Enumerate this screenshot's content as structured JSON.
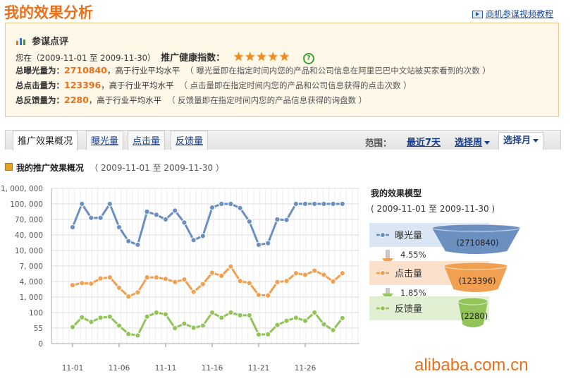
{
  "page": {
    "title": "我的效果分析",
    "tutorial_link": "商机参谋视频教程"
  },
  "summary": {
    "heading": "参谋点评",
    "period_prefix": "您在（",
    "period": "2009-11-01 至 2009-11-30",
    "period_suffix": "）",
    "health_label": "推广健康指数：",
    "health_stars": 5,
    "star_glyph": "★",
    "help_glyph": "?",
    "rows": [
      {
        "label": "总曝光量为：",
        "value": "2710840",
        "compare": "，高于行业平均水平",
        "note": "（ 曝光量即在指定时间内您的产品和公司信息在阿里巴巴中文站被买家看到的次数 ）"
      },
      {
        "label": "总点击量为：",
        "value": "123396",
        "compare": "，高于行业平均水平",
        "note": "（ 点击量即在指定时间内您的产品和公司信息获得的点击次数 ）"
      },
      {
        "label": "总反馈量为：",
        "value": "2280",
        "compare": "，高于行业平均水平",
        "note": "（ 反馈量即在指定时间内您的产品信息获得的询盘数 ）"
      }
    ]
  },
  "tabs": [
    {
      "label": "推广效果概况",
      "active": true
    },
    {
      "label": "曝光量",
      "active": false
    },
    {
      "label": "点击量",
      "active": false
    },
    {
      "label": "反馈量",
      "active": false
    }
  ],
  "range": {
    "label": "范围：",
    "last7": "最近7天",
    "week": "选择周",
    "month": "选择月"
  },
  "section": {
    "title": "我的推广效果概况",
    "period": "（ 2009-11-01 至 2009-11-30 ）"
  },
  "chart_data": {
    "type": "line",
    "y_ticks": [
      "1, 000, 000",
      "100, 000",
      "70, 000",
      "40, 000",
      "10, 000",
      "7, 000",
      "4, 000",
      "1, 000",
      "100",
      "55",
      "0"
    ],
    "x_ticks": [
      {
        "label": "11-01",
        "index": 0
      },
      {
        "label": "11-06",
        "index": 5
      },
      {
        "label": "11-11",
        "index": 10
      },
      {
        "label": "11-16",
        "index": 15
      },
      {
        "label": "11-21",
        "index": 20
      },
      {
        "label": "11-26",
        "index": 25
      }
    ],
    "grid": true,
    "series": [
      {
        "name": "曝光量",
        "color": "#6b8fbf",
        "values": [
          55000,
          100000,
          73000,
          73000,
          100000,
          55000,
          28000,
          21000,
          85000,
          79000,
          70000,
          87000,
          64000,
          30000,
          38000,
          93000,
          100000,
          100000,
          92000,
          66000,
          21000,
          24000,
          70000,
          69000,
          103000,
          103000,
          103000,
          102000,
          101000,
          102000
        ]
      },
      {
        "name": "点击量",
        "color": "#f0a050",
        "values": [
          3300,
          3700,
          3600,
          4600,
          4800,
          2800,
          1100,
          1900,
          4800,
          4800,
          4500,
          3900,
          4400,
          2000,
          3500,
          5700,
          5100,
          6900,
          4100,
          3700,
          1400,
          1300,
          3900,
          4100,
          5600,
          5300,
          6100,
          5300,
          4000,
          5600
        ]
      },
      {
        "name": "反馈量",
        "color": "#92c45a",
        "values": [
          58,
          86,
          73,
          85,
          88,
          62,
          34,
          29,
          88,
          100,
          95,
          55,
          68,
          56,
          62,
          100,
          85,
          100,
          92,
          92,
          32,
          33,
          64,
          76,
          85,
          76,
          100,
          66,
          48,
          84
        ]
      }
    ]
  },
  "model": {
    "title": "我的效果模型",
    "period": "( 2009-11-01 至 2009-11-30 )",
    "stages": [
      {
        "label": "曝光量",
        "value": "(2710840)",
        "color": "#6b8fbf"
      },
      {
        "label": "点击量",
        "value": "(123396)",
        "color": "#f0a050"
      },
      {
        "label": "反馈量",
        "value": "(2280)",
        "color": "#92c45a"
      }
    ],
    "rates": [
      "4.55%",
      "1.85%"
    ]
  },
  "watermark": "alibaba.com.cn"
}
